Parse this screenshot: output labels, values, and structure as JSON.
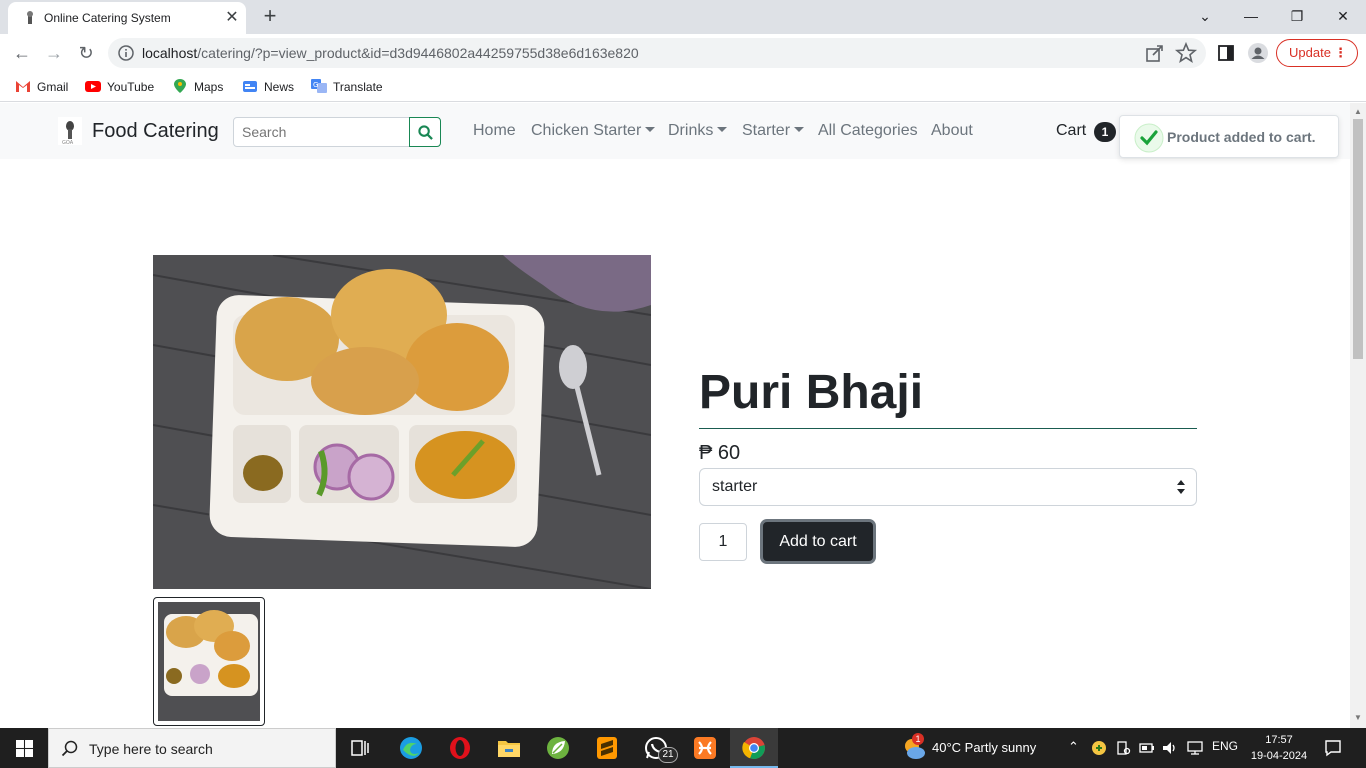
{
  "browser": {
    "tab_title": "Online Catering System",
    "url_host": "localhost",
    "url_path": "/catering/?p=view_product&id=d3d9446802a44259755d38e6d163e820",
    "update_label": "Update",
    "bookmarks": [
      {
        "label": "Gmail",
        "icon": "gmail-icon"
      },
      {
        "label": "YouTube",
        "icon": "youtube-icon"
      },
      {
        "label": "Maps",
        "icon": "maps-icon"
      },
      {
        "label": "News",
        "icon": "news-icon"
      },
      {
        "label": "Translate",
        "icon": "translate-icon"
      }
    ]
  },
  "site": {
    "brand": "Food Catering",
    "search_placeholder": "Search",
    "nav": {
      "home": "Home",
      "chicken_starter": "Chicken Starter",
      "drinks": "Drinks",
      "starter": "Starter",
      "all_categories": "All Categories",
      "about": "About"
    },
    "cart_label": "Cart",
    "cart_count": "1",
    "toast": "Product added to cart."
  },
  "product": {
    "name": "Puri Bhaji",
    "price": "₱ 60",
    "variant": "starter",
    "quantity": "1",
    "add_to_cart": "Add to cart"
  },
  "taskbar": {
    "search_placeholder": "Type here to search",
    "weather": "40°C  Partly sunny",
    "weather_badge": "1",
    "whatsapp_badge": "21",
    "language": "ENG",
    "time": "17:57",
    "date": "19-04-2024"
  },
  "colors": {
    "accent_success": "#198754",
    "dark": "#212529",
    "update_red": "#d93025"
  }
}
